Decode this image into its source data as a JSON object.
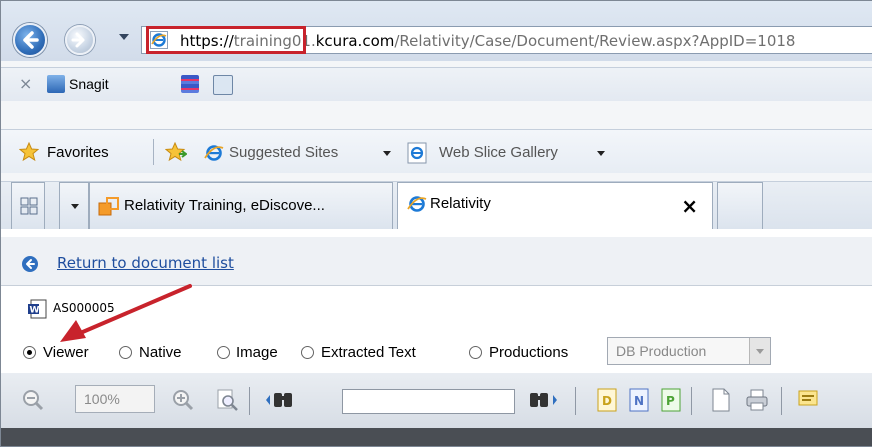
{
  "browser": {
    "address": {
      "scheme": "https://",
      "host_prefix": "training01.",
      "host_domain": "kcura.com",
      "path": "/Relativity/Case/Document/Review.aspx?AppID=1018"
    },
    "snagit": {
      "close_glyph": "×",
      "label": "Snagit"
    },
    "favorites": {
      "label": "Favorites",
      "items": [
        "Suggested Sites",
        "Web Slice Gallery"
      ]
    },
    "tabs": [
      {
        "label": "Relativity Training, eDiscove...",
        "icon": "relativity-icon"
      },
      {
        "label": "Relativity",
        "icon": "ie-icon",
        "close": "×"
      }
    ]
  },
  "page": {
    "return_link": "Return to document list",
    "document_id": "AS000005",
    "view_modes": [
      "Viewer",
      "Native",
      "Image",
      "Extracted Text",
      "Productions"
    ],
    "selected_mode": "Viewer",
    "production_select": {
      "value": "DB Production"
    },
    "toolbar": {
      "zoom": "100%",
      "search_value": ""
    }
  },
  "colors": {
    "highlight_red": "#c8232c",
    "link_blue": "#1f4e9e"
  }
}
